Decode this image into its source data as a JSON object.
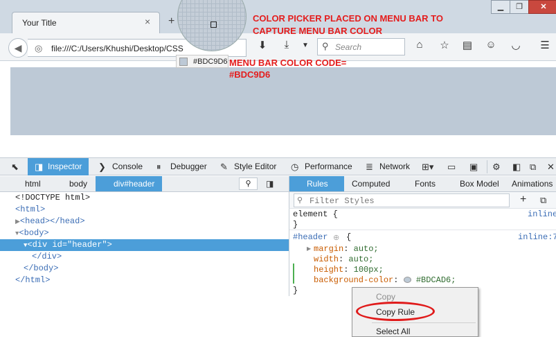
{
  "window": {
    "tab_title": "Your Title",
    "tab_close": "×",
    "new_tab": "+",
    "minimize": "▁",
    "maximize": "❐",
    "close": "✕"
  },
  "navbar": {
    "back": "◀",
    "url": "file:///C:/Users/Khushi/Desktop/CSS",
    "search_placeholder": "Search"
  },
  "picker": {
    "hex": "#BDC9D6"
  },
  "annotations": {
    "line1": "COLOR PICKER PLACED ON MENU BAR TO",
    "line2": "CAPTURE MENU BAR COLOR",
    "line3": "MENU BAR COLOR CODE=",
    "line4": "#BDC9D6"
  },
  "devtools": {
    "tabs": [
      "Inspector",
      "Console",
      "Debugger",
      "Style Editor",
      "Performance",
      "Network"
    ],
    "breadcrumb": [
      "html",
      "body",
      "div#header"
    ],
    "markup": [
      "<!DOCTYPE html>",
      "<html>",
      "<head></head>",
      "<body>",
      "<div id=\"header\">",
      "</div>",
      "</body>",
      "</html>"
    ],
    "side_tabs": [
      "Rules",
      "Computed",
      "Fonts",
      "Box Model",
      "Animations"
    ],
    "filter_placeholder": "Filter Styles",
    "rules": {
      "element_selector": "element {",
      "element_close": "}",
      "element_source": "inline",
      "header_selector": "#header",
      "header_open": "{",
      "header_source": "inline:7",
      "props": [
        {
          "name": "margin",
          "value": "auto;"
        },
        {
          "name": "width",
          "value": "auto;"
        },
        {
          "name": "height",
          "value": "100px;"
        },
        {
          "name": "background-color",
          "value": "#BDCAD6;"
        }
      ],
      "header_close": "}"
    }
  },
  "context_menu": {
    "items": [
      "Copy",
      "Copy Rule",
      "Select All"
    ]
  },
  "colors": {
    "menu_bar": "#BDC9D6",
    "accent": "#4C9ED9",
    "annotation": "#E41D1D"
  }
}
